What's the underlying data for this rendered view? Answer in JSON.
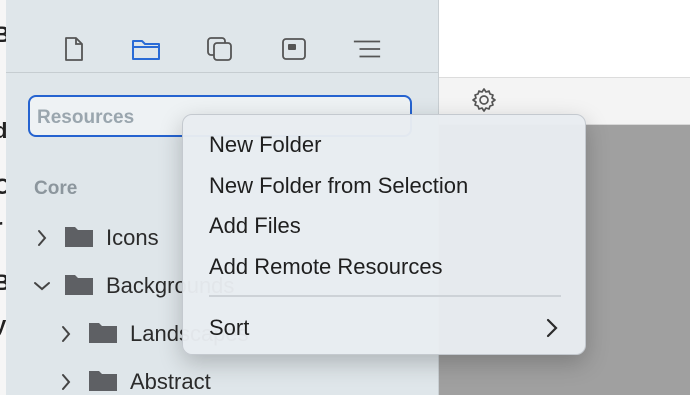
{
  "left_strip": {
    "glyphs": [
      "B",
      "d",
      "C",
      "r",
      "B",
      "y"
    ]
  },
  "toolbar": {
    "icons": [
      "document-icon",
      "folder-icon",
      "copy-icon",
      "panel-icon",
      "list-icon"
    ],
    "selected": "folder-icon",
    "accent": "#2a6bd6"
  },
  "search": {
    "value": "Resources"
  },
  "sidebar": {
    "section": "Core",
    "tree": [
      {
        "label": "Icons",
        "expanded": false,
        "level": 0
      },
      {
        "label": "Backgrounds",
        "expanded": true,
        "level": 0
      },
      {
        "label": "Landscapes",
        "expanded": false,
        "level": 1
      },
      {
        "label": "Abstract",
        "expanded": false,
        "level": 1
      }
    ]
  },
  "context_menu": {
    "items": [
      "New Folder",
      "New Folder from Selection",
      "Add Files",
      "Add Remote Resources"
    ],
    "sort_label": "Sort"
  },
  "colors": {
    "sidebar_bg": "#dfe6ea",
    "focus_ring": "#2563d0",
    "canvas": "#a0a0a0"
  }
}
